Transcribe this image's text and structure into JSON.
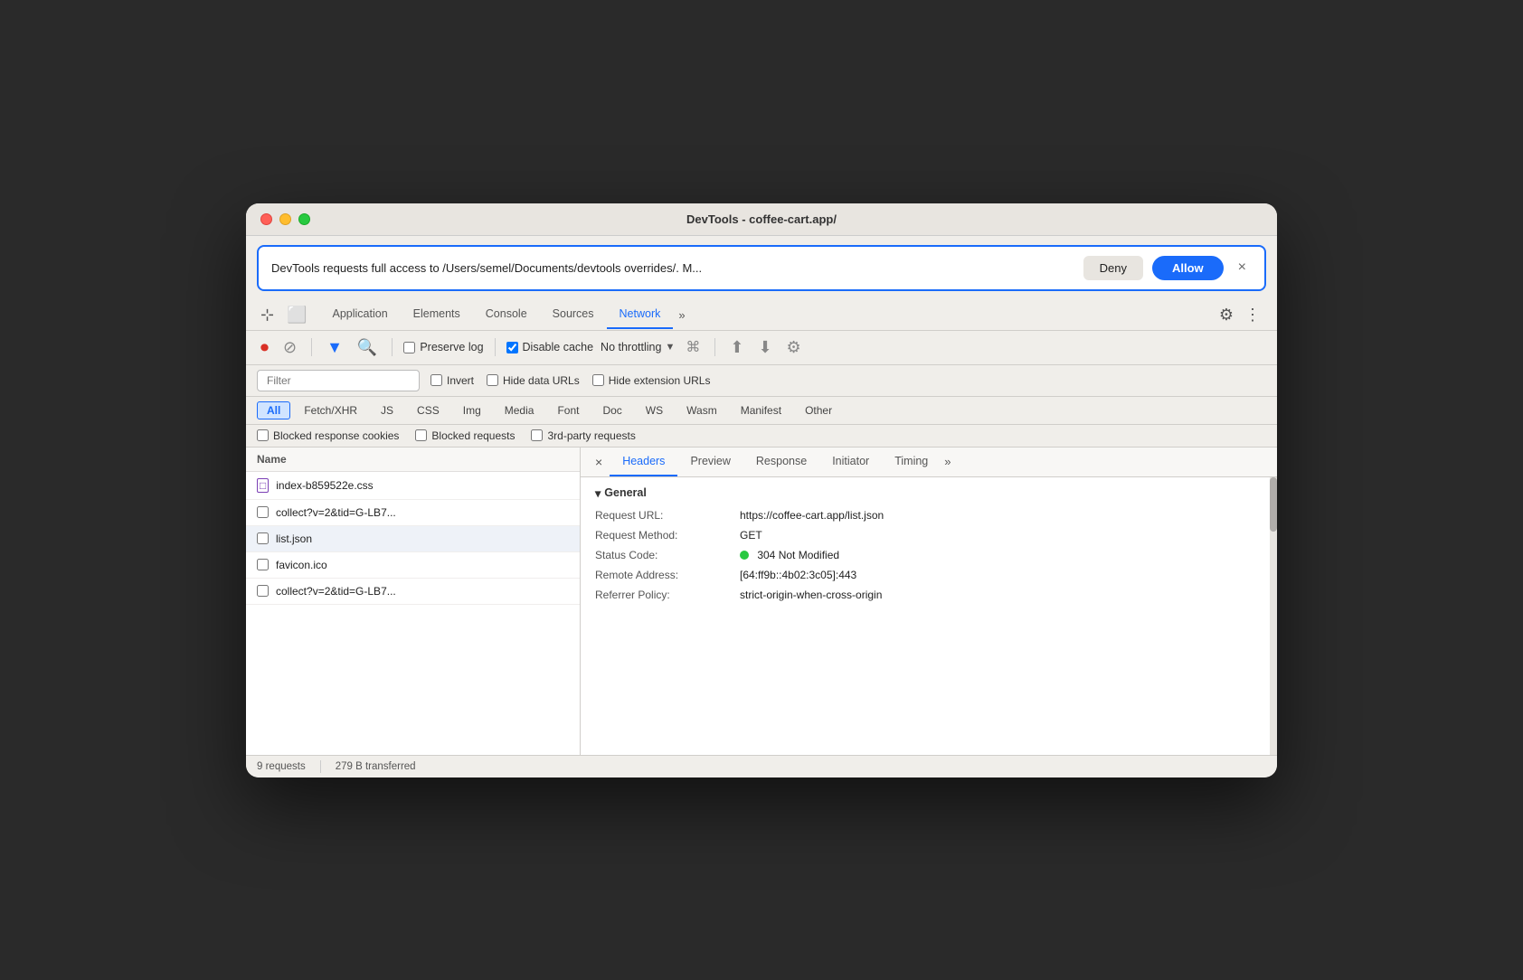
{
  "window": {
    "title": "DevTools - coffee-cart.app/"
  },
  "permission_banner": {
    "text": "DevTools requests full access to /Users/semel/Documents/devtools overrides/. M...",
    "deny_label": "Deny",
    "allow_label": "Allow",
    "close_label": "×"
  },
  "tabs": {
    "items": [
      {
        "label": "Application",
        "active": false
      },
      {
        "label": "Elements",
        "active": false
      },
      {
        "label": "Console",
        "active": false
      },
      {
        "label": "Sources",
        "active": false
      },
      {
        "label": "Network",
        "active": true
      }
    ],
    "more_label": "»",
    "settings_label": "⚙",
    "dots_label": "⋮"
  },
  "network_toolbar": {
    "stop_label": "⏺",
    "clear_label": "🚫",
    "filter_label": "▼",
    "search_label": "🔍",
    "preserve_log_label": "Preserve log",
    "disable_cache_label": "Disable cache",
    "throttle_label": "No throttling",
    "wifi_label": "📶",
    "upload_label": "⬆",
    "download_label": "⬇",
    "settings_label": "⚙"
  },
  "filter_bar": {
    "placeholder": "Filter",
    "invert_label": "Invert",
    "hide_data_urls_label": "Hide data URLs",
    "hide_extension_urls_label": "Hide extension URLs"
  },
  "resource_filters": [
    {
      "label": "All",
      "active": true
    },
    {
      "label": "Fetch/XHR",
      "active": false
    },
    {
      "label": "JS",
      "active": false
    },
    {
      "label": "CSS",
      "active": false
    },
    {
      "label": "Img",
      "active": false
    },
    {
      "label": "Media",
      "active": false
    },
    {
      "label": "Font",
      "active": false
    },
    {
      "label": "Doc",
      "active": false
    },
    {
      "label": "WS",
      "active": false
    },
    {
      "label": "Wasm",
      "active": false
    },
    {
      "label": "Manifest",
      "active": false
    },
    {
      "label": "Other",
      "active": false
    }
  ],
  "blocked_bar": {
    "blocked_cookies_label": "Blocked response cookies",
    "blocked_requests_label": "Blocked requests",
    "third_party_label": "3rd-party requests"
  },
  "file_list": {
    "header": "Name",
    "items": [
      {
        "name": "index-b859522e.css",
        "has_icon": true,
        "selected": false
      },
      {
        "name": "collect?v=2&tid=G-LB7...",
        "has_icon": false,
        "selected": false
      },
      {
        "name": "list.json",
        "has_icon": false,
        "selected": true
      },
      {
        "name": "favicon.ico",
        "has_icon": false,
        "selected": false
      },
      {
        "name": "collect?v=2&tid=G-LB7...",
        "has_icon": false,
        "selected": false
      }
    ]
  },
  "details": {
    "close_label": "×",
    "tabs": [
      {
        "label": "Headers",
        "active": true
      },
      {
        "label": "Preview",
        "active": false
      },
      {
        "label": "Response",
        "active": false
      },
      {
        "label": "Initiator",
        "active": false
      },
      {
        "label": "Timing",
        "active": false
      }
    ],
    "more_label": "»",
    "section_label": "▾General",
    "rows": [
      {
        "key": "Request URL:",
        "value": "https://coffee-cart.app/list.json"
      },
      {
        "key": "Request Method:",
        "value": "GET"
      },
      {
        "key": "Status Code:",
        "value": "304 Not Modified",
        "has_dot": true
      },
      {
        "key": "Remote Address:",
        "value": "[64:ff9b::4b02:3c05]:443"
      },
      {
        "key": "Referrer Policy:",
        "value": "strict-origin-when-cross-origin"
      }
    ]
  },
  "status_bar": {
    "requests": "9 requests",
    "transferred": "279 B transferred"
  }
}
